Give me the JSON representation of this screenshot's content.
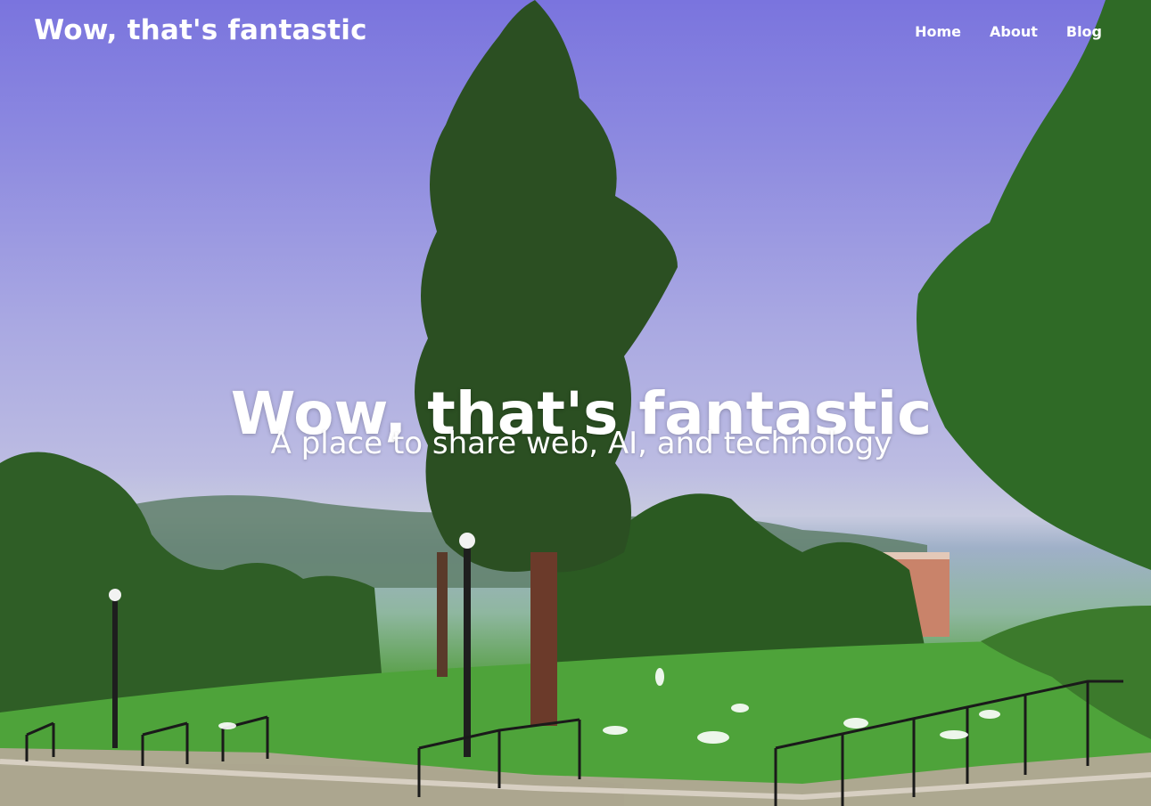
{
  "site": {
    "brand": "Wow, that's fantastic"
  },
  "nav": {
    "items": [
      {
        "label": "Home"
      },
      {
        "label": "About"
      },
      {
        "label": "Blog"
      }
    ]
  },
  "hero": {
    "title": "Wow, that's fantastic",
    "subtitle": "A place to share web, AI, and technology",
    "background_image": "photo of a grassy campus lawn with tall pine tree, people sitting, staircase railings, blue-purple sky"
  },
  "colors": {
    "text": "#ffffff",
    "sky_top": "#7a74de",
    "sky_bottom": "#c8cbe0",
    "grass": "#4c9a38",
    "tree_dark": "#2e5a24"
  }
}
